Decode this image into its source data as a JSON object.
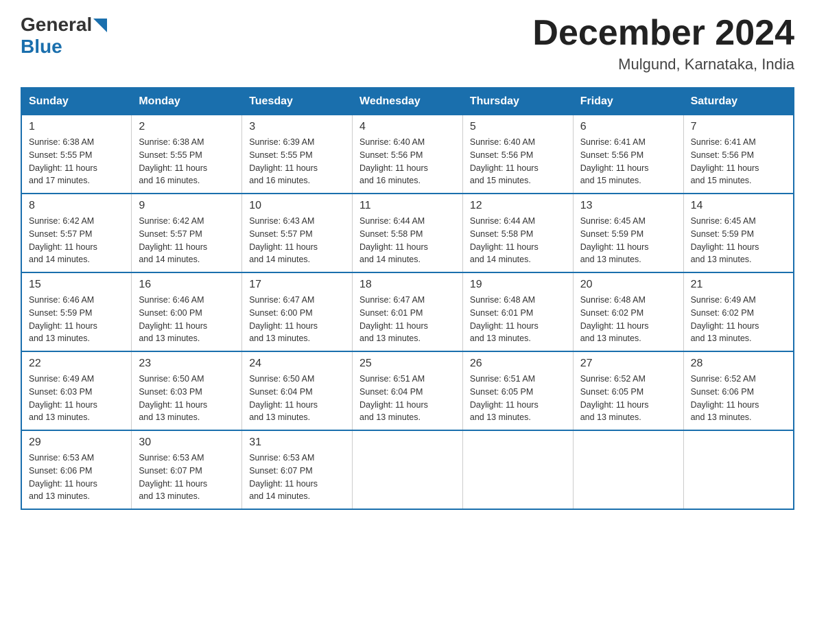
{
  "header": {
    "logo": {
      "general": "General",
      "triangle_color": "#1a6fad",
      "blue": "Blue"
    },
    "title": "December 2024",
    "location": "Mulgund, Karnataka, India"
  },
  "calendar": {
    "days_of_week": [
      "Sunday",
      "Monday",
      "Tuesday",
      "Wednesday",
      "Thursday",
      "Friday",
      "Saturday"
    ],
    "weeks": [
      [
        {
          "day": "1",
          "sunrise": "6:38 AM",
          "sunset": "5:55 PM",
          "daylight": "11 hours and 17 minutes."
        },
        {
          "day": "2",
          "sunrise": "6:38 AM",
          "sunset": "5:55 PM",
          "daylight": "11 hours and 16 minutes."
        },
        {
          "day": "3",
          "sunrise": "6:39 AM",
          "sunset": "5:55 PM",
          "daylight": "11 hours and 16 minutes."
        },
        {
          "day": "4",
          "sunrise": "6:40 AM",
          "sunset": "5:56 PM",
          "daylight": "11 hours and 16 minutes."
        },
        {
          "day": "5",
          "sunrise": "6:40 AM",
          "sunset": "5:56 PM",
          "daylight": "11 hours and 15 minutes."
        },
        {
          "day": "6",
          "sunrise": "6:41 AM",
          "sunset": "5:56 PM",
          "daylight": "11 hours and 15 minutes."
        },
        {
          "day": "7",
          "sunrise": "6:41 AM",
          "sunset": "5:56 PM",
          "daylight": "11 hours and 15 minutes."
        }
      ],
      [
        {
          "day": "8",
          "sunrise": "6:42 AM",
          "sunset": "5:57 PM",
          "daylight": "11 hours and 14 minutes."
        },
        {
          "day": "9",
          "sunrise": "6:42 AM",
          "sunset": "5:57 PM",
          "daylight": "11 hours and 14 minutes."
        },
        {
          "day": "10",
          "sunrise": "6:43 AM",
          "sunset": "5:57 PM",
          "daylight": "11 hours and 14 minutes."
        },
        {
          "day": "11",
          "sunrise": "6:44 AM",
          "sunset": "5:58 PM",
          "daylight": "11 hours and 14 minutes."
        },
        {
          "day": "12",
          "sunrise": "6:44 AM",
          "sunset": "5:58 PM",
          "daylight": "11 hours and 14 minutes."
        },
        {
          "day": "13",
          "sunrise": "6:45 AM",
          "sunset": "5:59 PM",
          "daylight": "11 hours and 13 minutes."
        },
        {
          "day": "14",
          "sunrise": "6:45 AM",
          "sunset": "5:59 PM",
          "daylight": "11 hours and 13 minutes."
        }
      ],
      [
        {
          "day": "15",
          "sunrise": "6:46 AM",
          "sunset": "5:59 PM",
          "daylight": "11 hours and 13 minutes."
        },
        {
          "day": "16",
          "sunrise": "6:46 AM",
          "sunset": "6:00 PM",
          "daylight": "11 hours and 13 minutes."
        },
        {
          "day": "17",
          "sunrise": "6:47 AM",
          "sunset": "6:00 PM",
          "daylight": "11 hours and 13 minutes."
        },
        {
          "day": "18",
          "sunrise": "6:47 AM",
          "sunset": "6:01 PM",
          "daylight": "11 hours and 13 minutes."
        },
        {
          "day": "19",
          "sunrise": "6:48 AM",
          "sunset": "6:01 PM",
          "daylight": "11 hours and 13 minutes."
        },
        {
          "day": "20",
          "sunrise": "6:48 AM",
          "sunset": "6:02 PM",
          "daylight": "11 hours and 13 minutes."
        },
        {
          "day": "21",
          "sunrise": "6:49 AM",
          "sunset": "6:02 PM",
          "daylight": "11 hours and 13 minutes."
        }
      ],
      [
        {
          "day": "22",
          "sunrise": "6:49 AM",
          "sunset": "6:03 PM",
          "daylight": "11 hours and 13 minutes."
        },
        {
          "day": "23",
          "sunrise": "6:50 AM",
          "sunset": "6:03 PM",
          "daylight": "11 hours and 13 minutes."
        },
        {
          "day": "24",
          "sunrise": "6:50 AM",
          "sunset": "6:04 PM",
          "daylight": "11 hours and 13 minutes."
        },
        {
          "day": "25",
          "sunrise": "6:51 AM",
          "sunset": "6:04 PM",
          "daylight": "11 hours and 13 minutes."
        },
        {
          "day": "26",
          "sunrise": "6:51 AM",
          "sunset": "6:05 PM",
          "daylight": "11 hours and 13 minutes."
        },
        {
          "day": "27",
          "sunrise": "6:52 AM",
          "sunset": "6:05 PM",
          "daylight": "11 hours and 13 minutes."
        },
        {
          "day": "28",
          "sunrise": "6:52 AM",
          "sunset": "6:06 PM",
          "daylight": "11 hours and 13 minutes."
        }
      ],
      [
        {
          "day": "29",
          "sunrise": "6:53 AM",
          "sunset": "6:06 PM",
          "daylight": "11 hours and 13 minutes."
        },
        {
          "day": "30",
          "sunrise": "6:53 AM",
          "sunset": "6:07 PM",
          "daylight": "11 hours and 13 minutes."
        },
        {
          "day": "31",
          "sunrise": "6:53 AM",
          "sunset": "6:07 PM",
          "daylight": "11 hours and 14 minutes."
        },
        null,
        null,
        null,
        null
      ]
    ],
    "labels": {
      "sunrise": "Sunrise: ",
      "sunset": "Sunset: ",
      "daylight": "Daylight: "
    }
  }
}
